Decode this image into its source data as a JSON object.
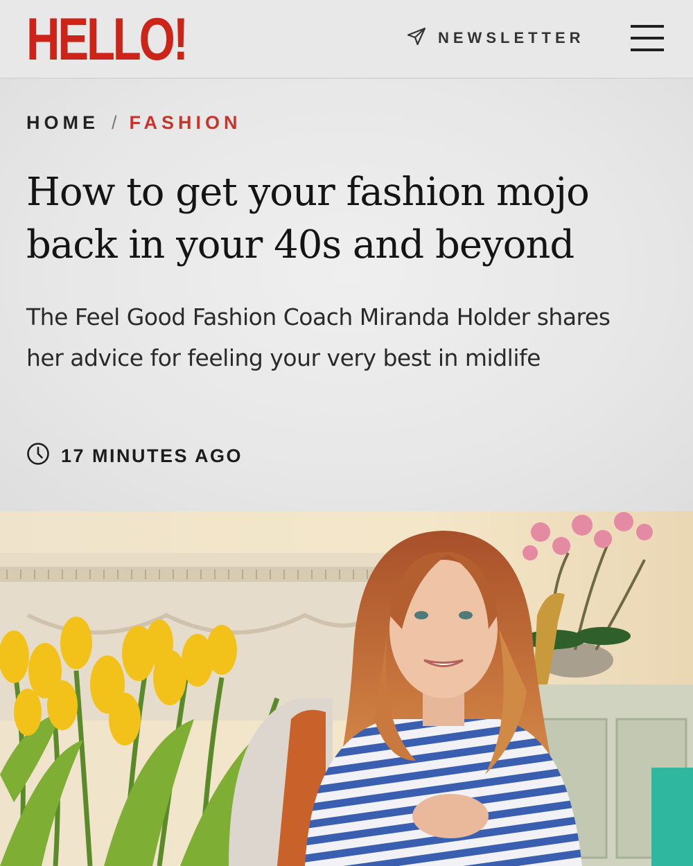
{
  "header": {
    "logo_text": "HELLO!",
    "newsletter_label": "NEWSLETTER",
    "brand_color": "#cc2418",
    "icons": [
      "send-icon",
      "hamburger-menu-icon"
    ]
  },
  "breadcrumb": {
    "home": "HOME",
    "separator": "/",
    "current": "FASHION"
  },
  "article": {
    "title": "How to get your fashion mojo back in your 40s and beyond",
    "subtitle": "The Feel Good Fashion Coach Miranda Holder shares her advice for feeling your very best in midlife",
    "timestamp": "17 MINUTES AGO",
    "timestamp_icon": "clock-icon"
  },
  "hero_image": {
    "subject": "woman-in-striped-top-with-yellow-tulips"
  }
}
